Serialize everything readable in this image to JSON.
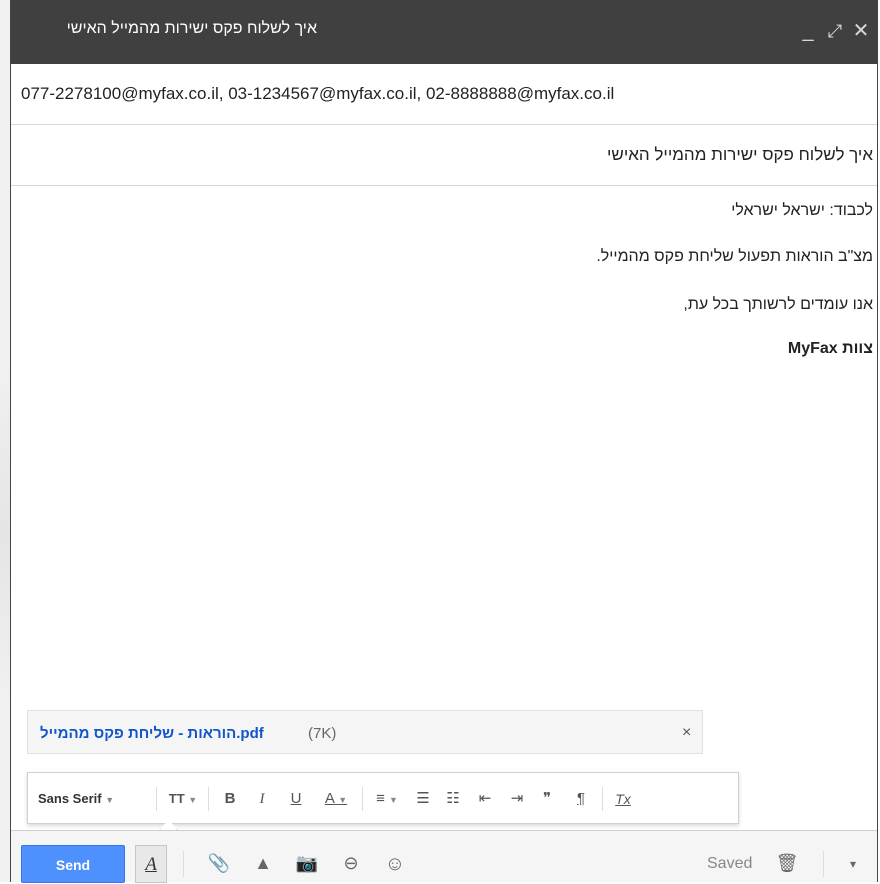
{
  "window": {
    "title": "איך לשלוח פקס ישירות מהמייל האישי",
    "minimize_glyph": "_",
    "expand_glyph": "⤢",
    "close_glyph": "✕"
  },
  "compose": {
    "to": "077-2278100@myfax.co.il, 03-1234567@myfax.co.il, 02-8888888@myfax.co.il",
    "subject": "איך לשלוח פקס ישירות מהמייל האישי",
    "body_lines": [
      "לכבוד: ישראל ישראלי",
      "מצ\"ב הוראות תפעול שליחת פקס מהמייל.",
      "אנו עומדים לרשותך בכל עת,",
      "צוות MyFax"
    ]
  },
  "attachment": {
    "name": "הוראות - שליחת פקס מהמייל.pdf",
    "size": "(7K)",
    "remove_glyph": "×"
  },
  "format_toolbar": {
    "font": "Sans Serif",
    "size_glyph": "TT",
    "bold": "B",
    "italic": "I",
    "underline": "U",
    "text_color": "A",
    "align_glyph": "≡",
    "numbered_glyph": "☰",
    "bulleted_glyph": "☷",
    "indent_less_glyph": "⇤",
    "indent_more_glyph": "⇥",
    "quote_glyph": "❞",
    "rtl_glyph": "¶",
    "remove_format_glyph": "Tx"
  },
  "bottom_toolbar": {
    "send_label": "Send",
    "format_toggle_label": "A",
    "attach_glyph": "📎",
    "drive_glyph": "▲",
    "photo_glyph": "📷",
    "link_glyph": "⊖",
    "emoji_glyph": "☺",
    "saved_label": "Saved",
    "discard_glyph": "🗑",
    "more_glyph": "▾"
  },
  "colors": {
    "titlebar": "#404040",
    "send_button": "#4d90fe",
    "attachment_link": "#1155cc"
  }
}
